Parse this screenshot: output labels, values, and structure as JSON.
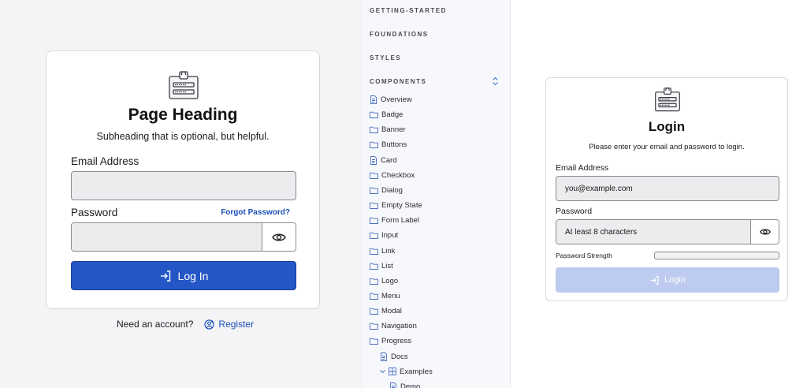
{
  "left_card": {
    "heading": "Page Heading",
    "subheading": "Subheading that is optional, but helpful.",
    "email_label": "Email Address",
    "email_value": "",
    "password_label": "Password",
    "forgot_link": "Forgot Password?",
    "password_value": "",
    "login_button": "Log In",
    "need_account": "Need an account?",
    "register_link": "Register"
  },
  "nav": {
    "sections": [
      "GETTING-STARTED",
      "FOUNDATIONS",
      "STYLES",
      "COMPONENTS"
    ],
    "items": [
      {
        "label": "Overview",
        "icon": "file-icon"
      },
      {
        "label": "Badge",
        "icon": "folder-icon"
      },
      {
        "label": "Banner",
        "icon": "folder-icon"
      },
      {
        "label": "Buttons",
        "icon": "folder-icon"
      },
      {
        "label": "Card",
        "icon": "file-icon"
      },
      {
        "label": "Checkbox",
        "icon": "folder-icon"
      },
      {
        "label": "Dialog",
        "icon": "folder-icon"
      },
      {
        "label": "Empty State",
        "icon": "folder-icon"
      },
      {
        "label": "Form Label",
        "icon": "folder-icon"
      },
      {
        "label": "Input",
        "icon": "folder-icon"
      },
      {
        "label": "Link",
        "icon": "folder-icon"
      },
      {
        "label": "List",
        "icon": "folder-icon"
      },
      {
        "label": "Logo",
        "icon": "folder-icon"
      },
      {
        "label": "Menu",
        "icon": "folder-icon"
      },
      {
        "label": "Modal",
        "icon": "folder-icon"
      },
      {
        "label": "Navigation",
        "icon": "folder-icon"
      },
      {
        "label": "Progress",
        "icon": "folder-icon"
      },
      {
        "label": "Docs",
        "icon": "file-icon"
      },
      {
        "label": "Examples",
        "icon": "grid-icon"
      },
      {
        "label": "Demo",
        "icon": "file-icon"
      }
    ]
  },
  "right_card": {
    "heading": "Login",
    "subheading": "Please enter your email and password to login.",
    "email_label": "Email Address",
    "email_placeholder": "you@example.com",
    "password_label": "Password",
    "password_placeholder": "At least 8 characters",
    "strength_label": "Password Strength",
    "login_button": "Login"
  },
  "colors": {
    "primary": "#2457c5",
    "primary_disabled": "#bccbef",
    "link": "#1a4fb5"
  }
}
